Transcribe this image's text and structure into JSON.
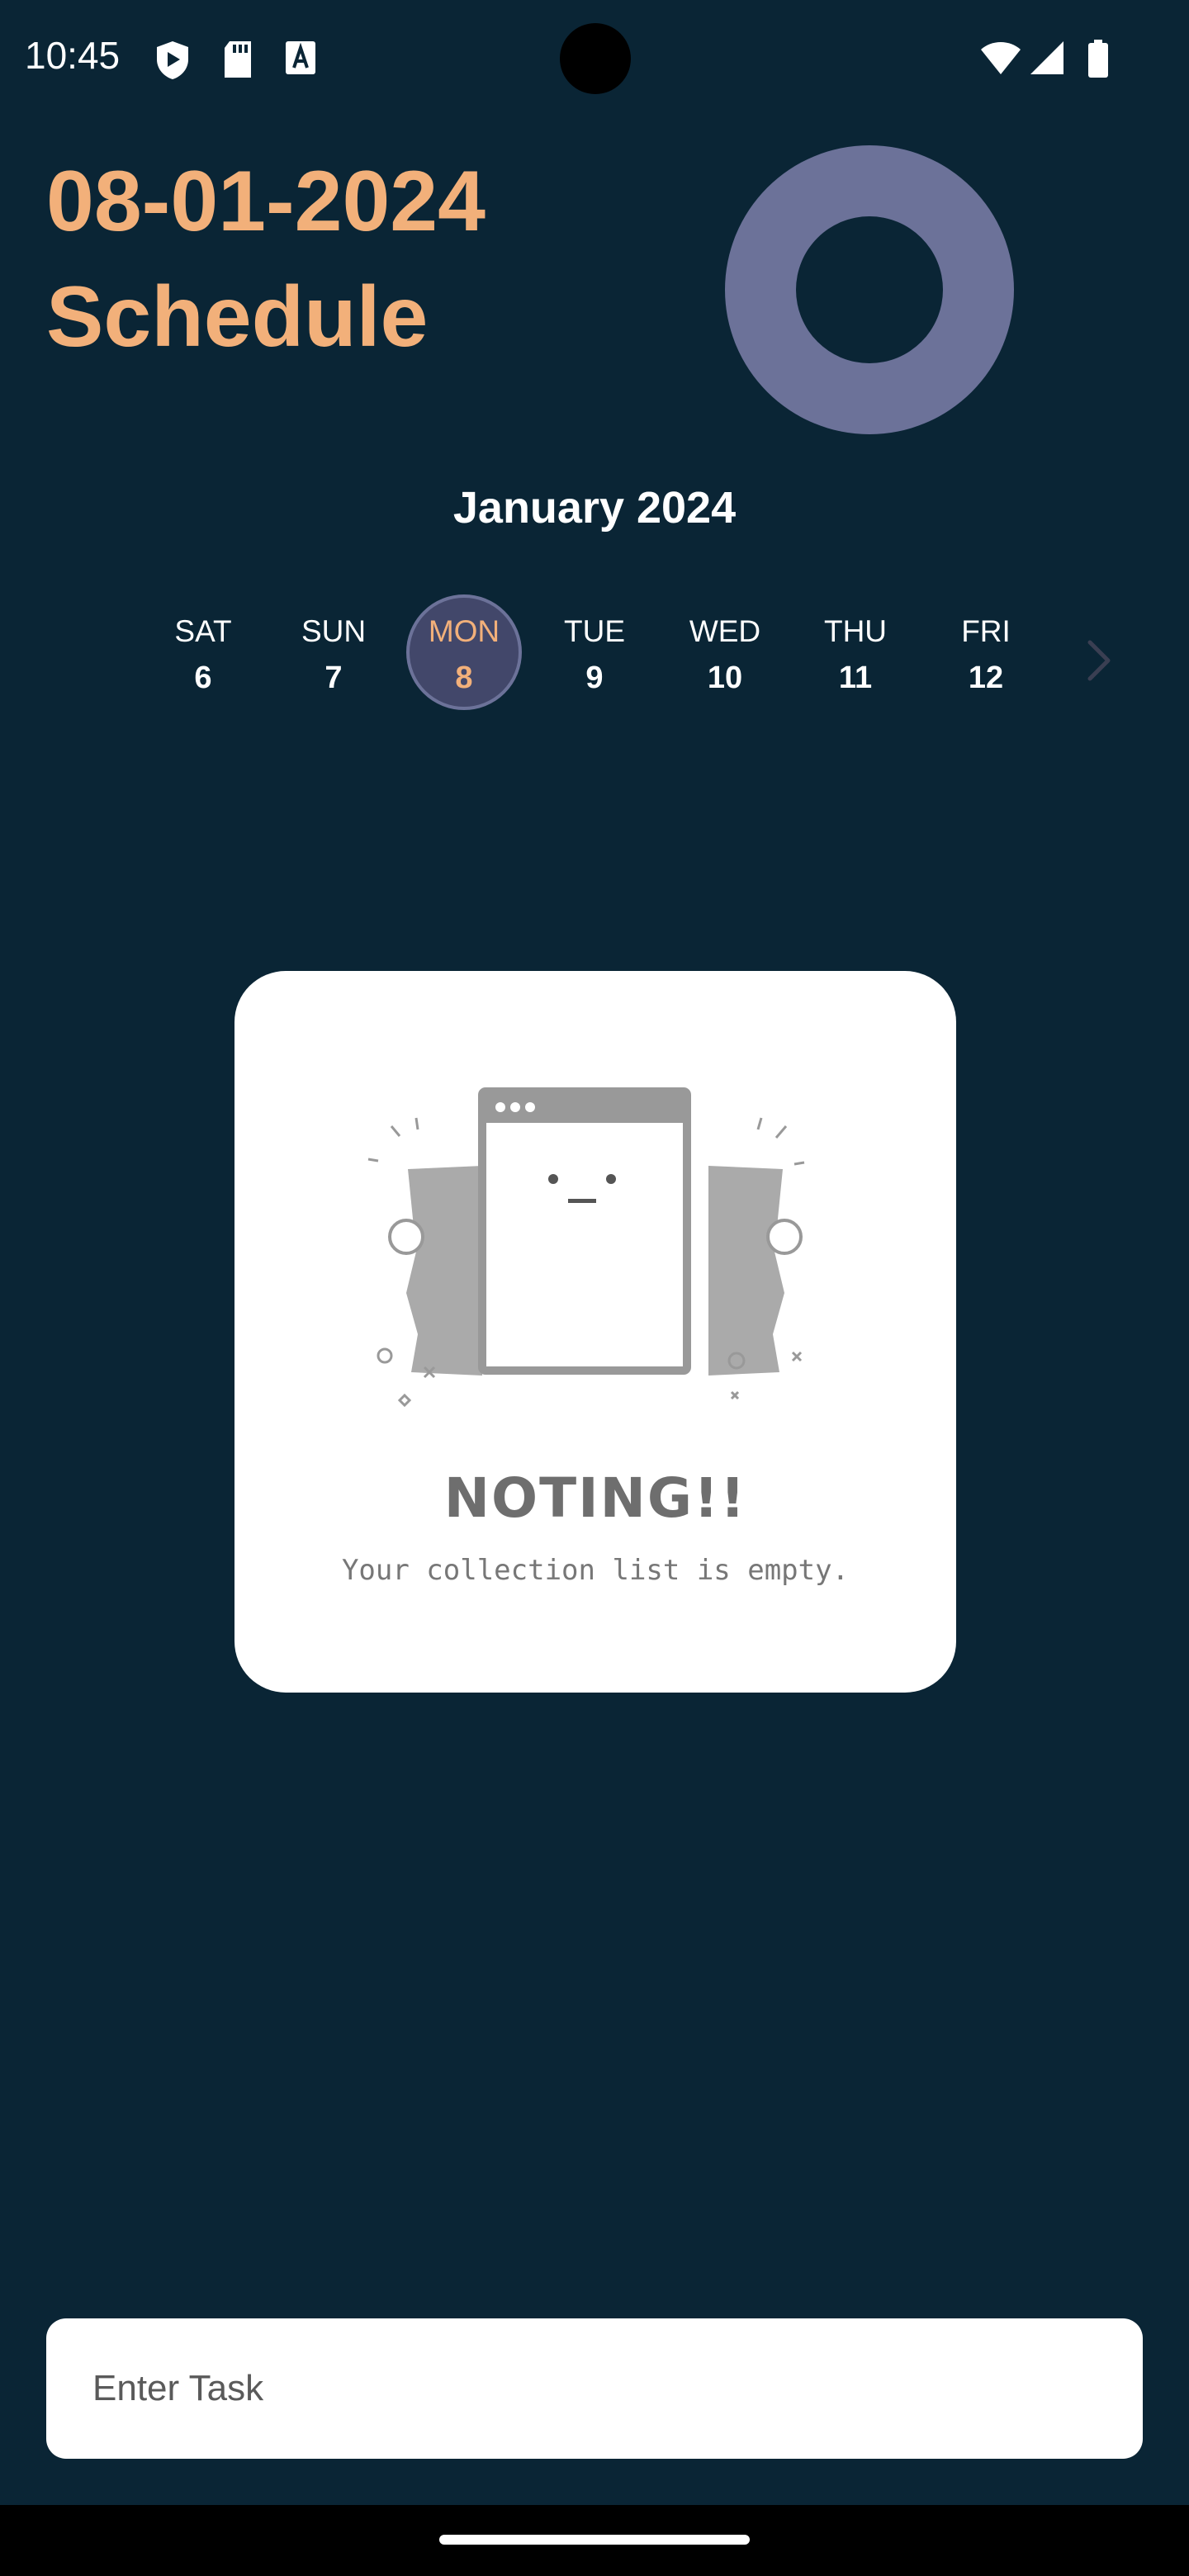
{
  "status_bar": {
    "time": "10:45",
    "icons": [
      "play-protect-icon",
      "sd-card-icon",
      "font-download-icon",
      "wifi-icon",
      "cell-signal-icon",
      "battery-icon"
    ]
  },
  "header": {
    "date": "08-01-2024",
    "title": "Schedule"
  },
  "calendar": {
    "month_label": "January 2024",
    "days": [
      {
        "name": "SAT",
        "date": "6"
      },
      {
        "name": "SUN",
        "date": "7"
      },
      {
        "name": "MON",
        "date": "8",
        "selected": true
      },
      {
        "name": "TUE",
        "date": "9"
      },
      {
        "name": "WED",
        "date": "10"
      },
      {
        "name": "THU",
        "date": "11"
      },
      {
        "name": "FRI",
        "date": "12"
      }
    ]
  },
  "empty_state": {
    "title": "NOTING!!",
    "subtitle": "Your collection list is empty."
  },
  "task_input": {
    "placeholder": "Enter Task",
    "value": ""
  },
  "colors": {
    "background": "#0a2535",
    "accent": "#f2b07a",
    "ring": "#6c7299",
    "selected_day_bg": "#42476a"
  }
}
